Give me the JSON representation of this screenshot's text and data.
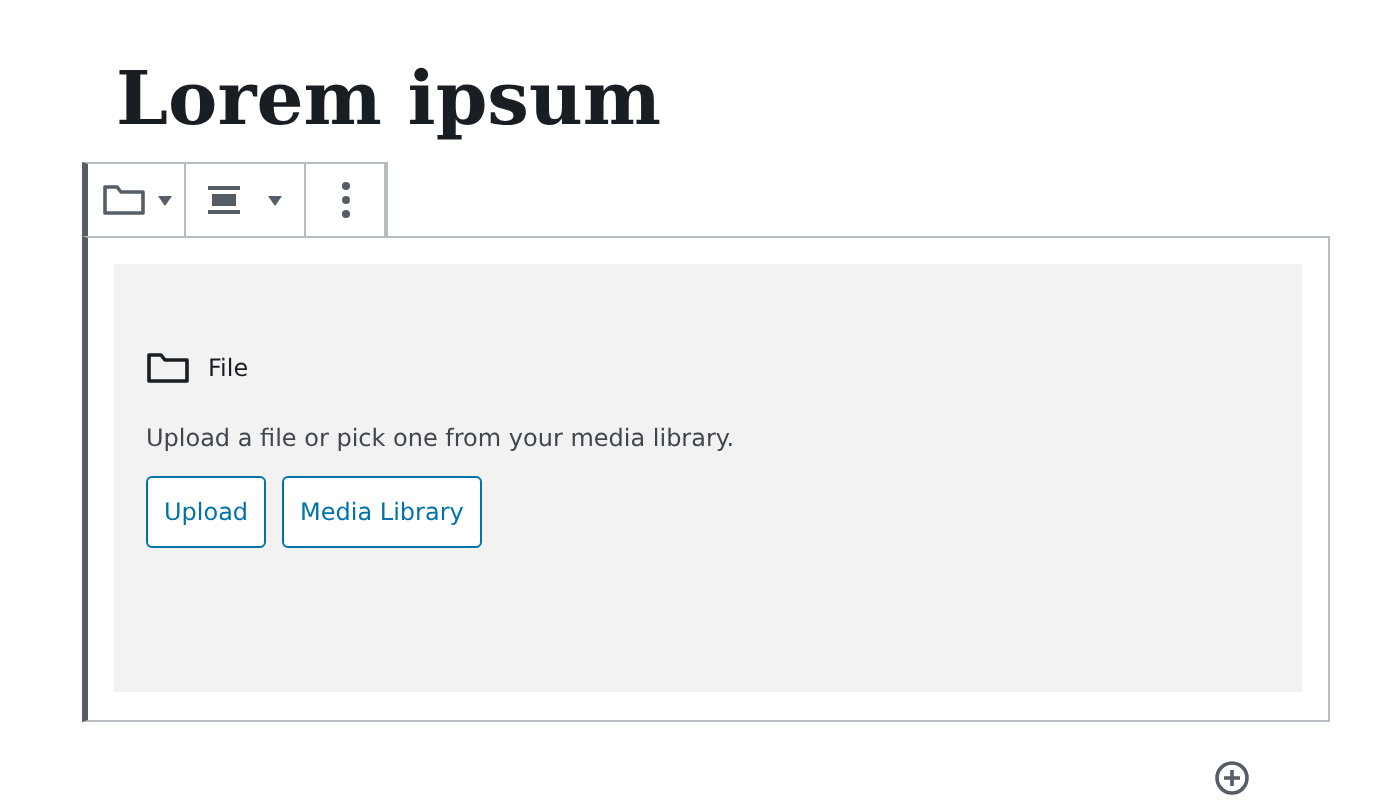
{
  "title": "Lorem ipsum",
  "block": {
    "label": "File",
    "instructions": "Upload a file or pick one from your media library.",
    "buttons": [
      "Upload",
      "Media Library"
    ]
  }
}
